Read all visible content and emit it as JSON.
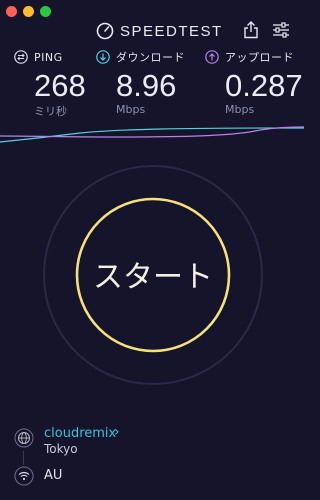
{
  "header": {
    "title": "SPEEDTEST"
  },
  "metrics": {
    "ping": {
      "label": "PING",
      "value": "268",
      "unit": "ミリ秒",
      "color": "#d9d9e6"
    },
    "download": {
      "label": "ダウンロード",
      "value": "8.96",
      "unit": "Mbps",
      "color": "#55d0df"
    },
    "upload": {
      "label": "アップロード",
      "value": "0.287",
      "unit": "Mbps",
      "color": "#b583e8"
    }
  },
  "start_button": {
    "label": "スタート",
    "ring_color": "#f3e27a"
  },
  "server": {
    "name": "cloudremix",
    "chevron": "›",
    "city": "Tokyo"
  },
  "connection": {
    "isp": "AU"
  },
  "icons": [
    "speedometer-icon",
    "share-icon",
    "settings-icon",
    "ping-icon",
    "download-icon",
    "upload-icon",
    "globe-icon",
    "wifi-icon"
  ]
}
